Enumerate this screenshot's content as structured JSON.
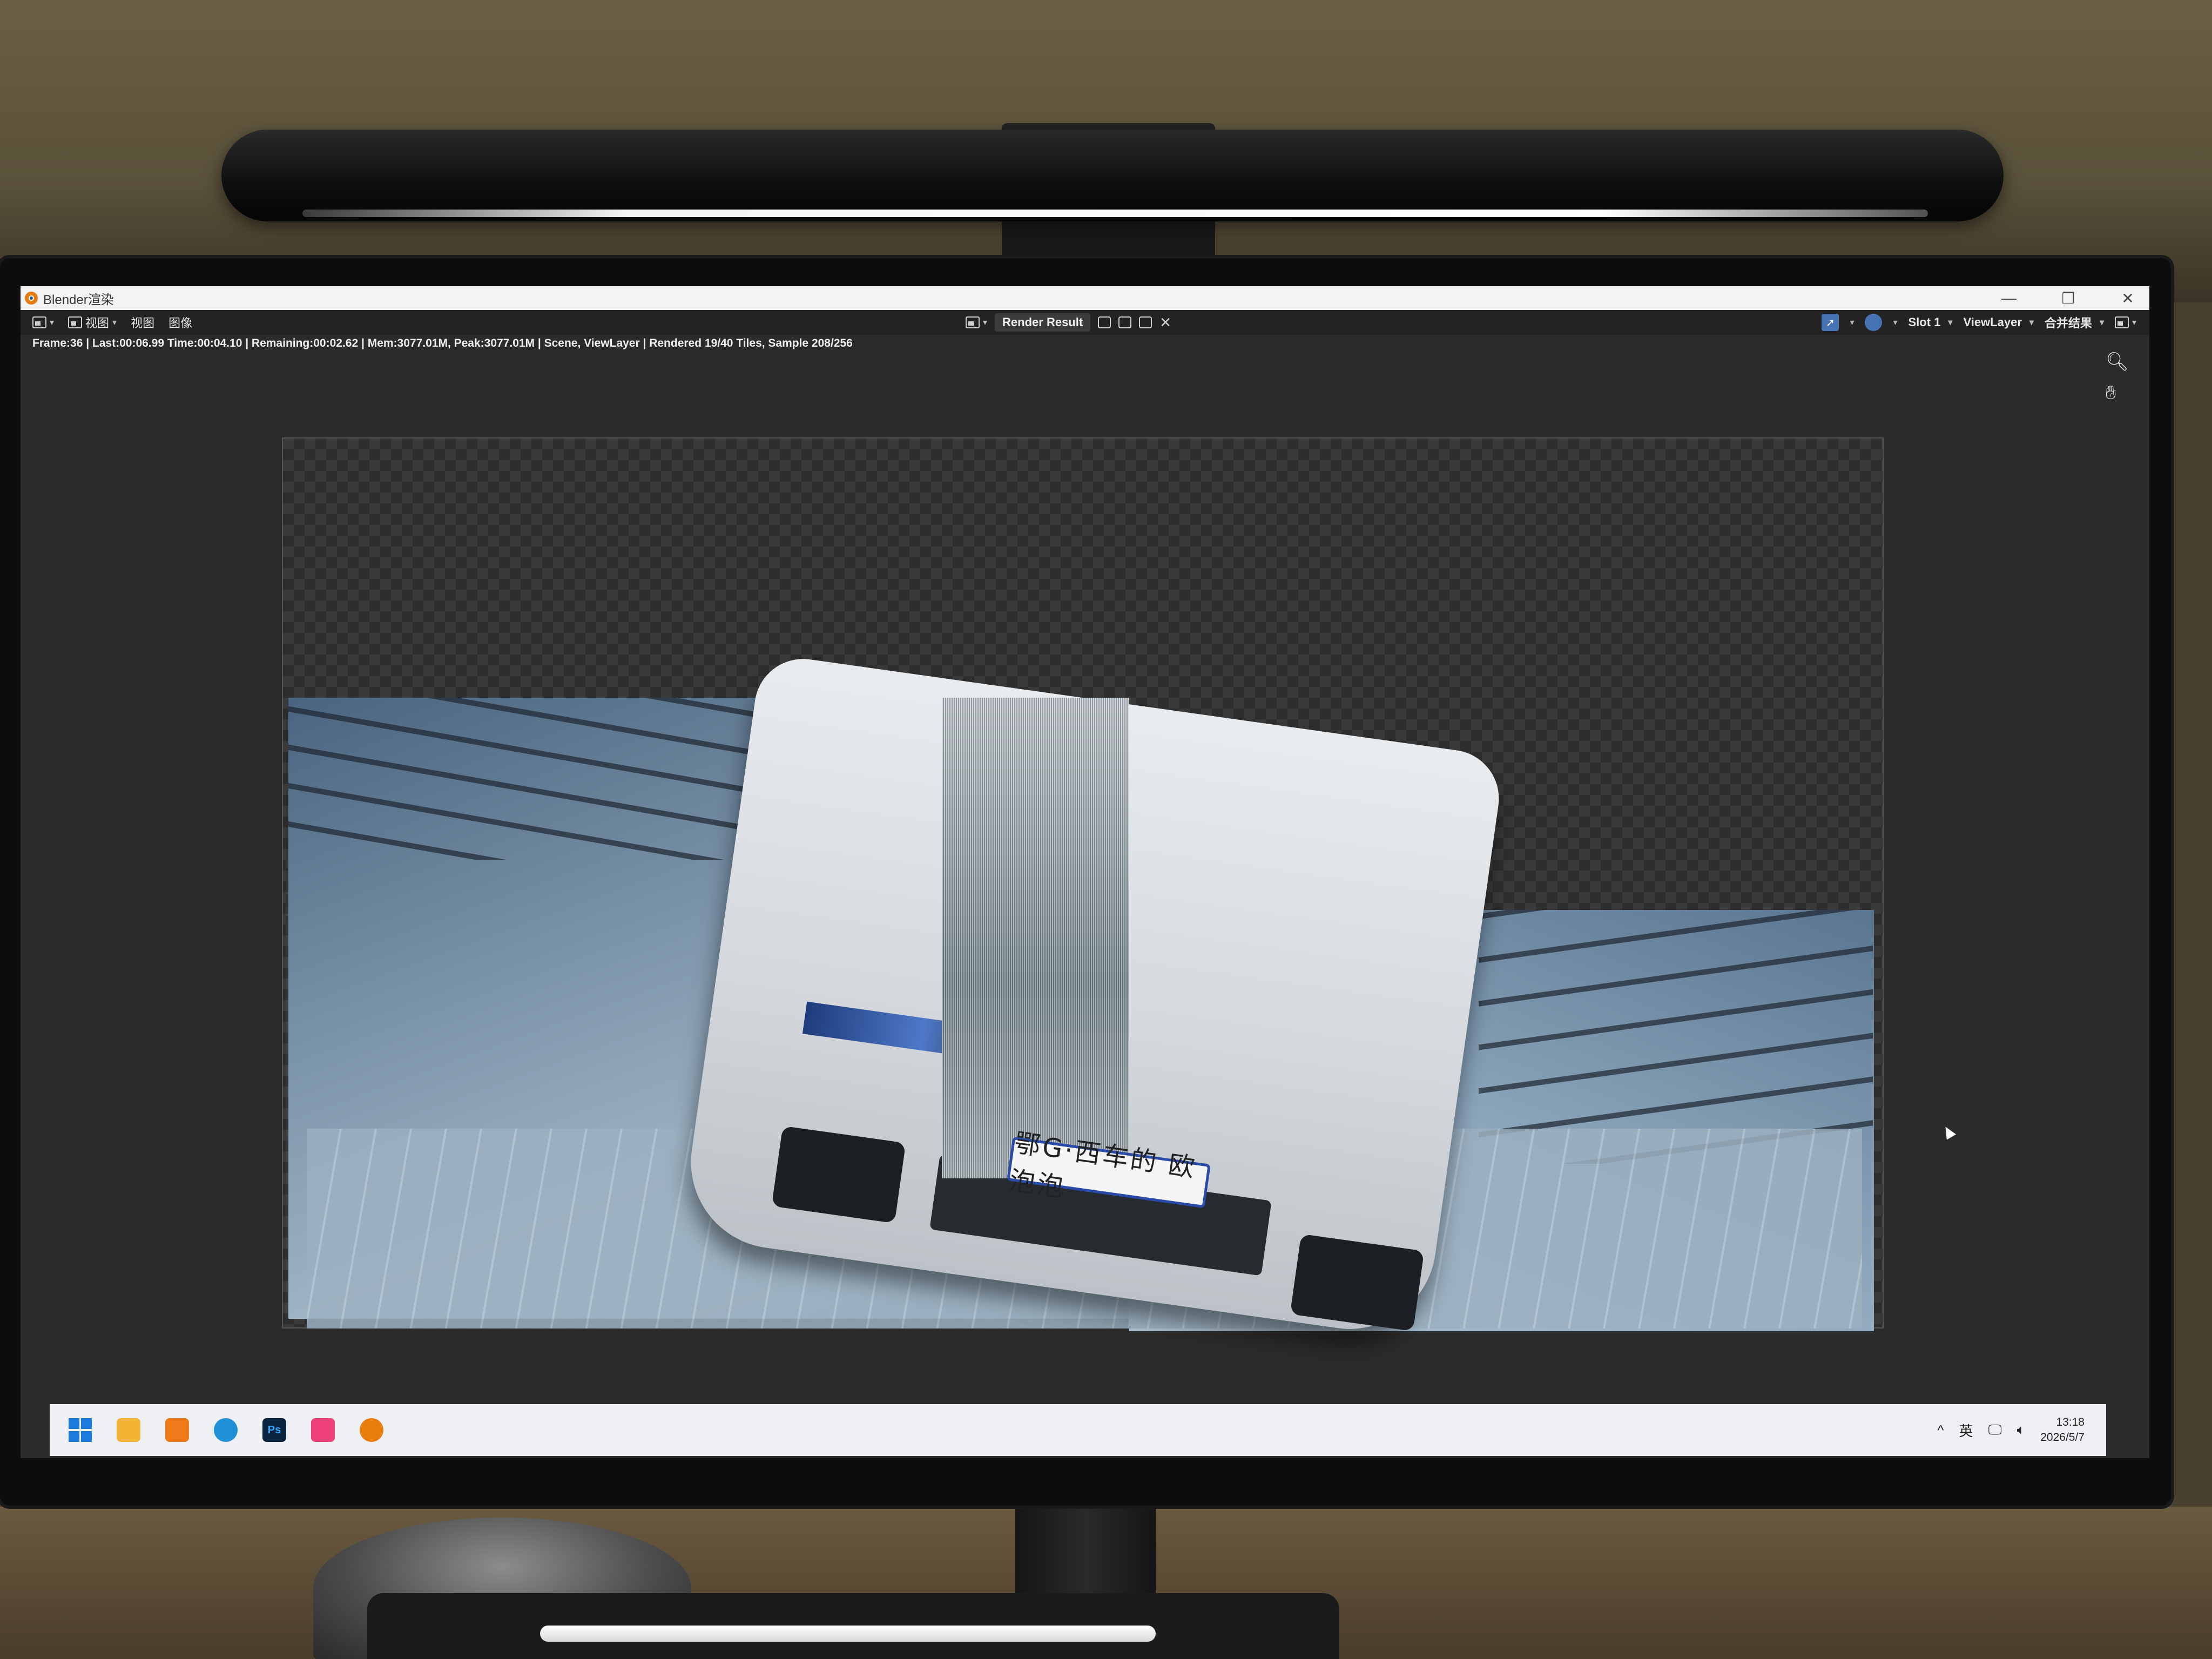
{
  "window": {
    "title": "Blender渲染",
    "controls": {
      "minimize": "—",
      "restore": "❐",
      "close": "✕"
    }
  },
  "header": {
    "menus": [
      "视图",
      "视图",
      "图像"
    ],
    "image_name": "Render Result",
    "slot": "Slot 1",
    "view_layer": "ViewLayer",
    "pass": "合并结果"
  },
  "stats": "Frame:36 | Last:00:06.99 Time:00:04.10 | Remaining:00:02.62 | Mem:3077.01M, Peak:3077.01M | Scene, ViewLayer | Rendered 19/40 Tiles, Sample 208/256",
  "render": {
    "plate_text": "鄂G·西车的 欧泡泡",
    "tiles_rendered": 19,
    "tiles_total": 40,
    "sample": 208,
    "sample_total": 256
  },
  "taskbar": {
    "apps": [
      {
        "name": "start",
        "icon": "windows-icon"
      },
      {
        "name": "file-explorer",
        "icon": "folder-icon",
        "color": "#f2b233"
      },
      {
        "name": "store-app",
        "icon": "bag-icon",
        "color": "#f07a1a"
      },
      {
        "name": "edge",
        "icon": "edge-icon",
        "color": "#1f8fd6"
      },
      {
        "name": "photoshop",
        "icon": "photoshop-icon",
        "label": "Ps",
        "color": "#0b2440"
      },
      {
        "name": "app-pink",
        "icon": "pink-app-icon",
        "color": "#f0407a"
      },
      {
        "name": "blender",
        "icon": "blender-icon",
        "color": "#e87d0d"
      }
    ],
    "tray": {
      "chevron": "^",
      "ime": "英",
      "time": "13:18",
      "date": "2026/5/7"
    }
  },
  "colors": {
    "blender_bg": "#2b2b2b",
    "header_bg": "#232323",
    "accent_blue": "#4772b3",
    "blender_orange": "#e87d0d"
  }
}
